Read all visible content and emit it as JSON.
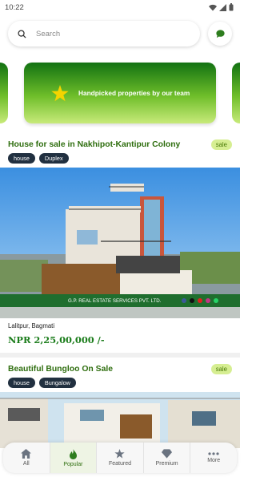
{
  "status": {
    "time": "10:22"
  },
  "search": {
    "placeholder": "Search"
  },
  "banner": {
    "text": "Handpicked properties by our team"
  },
  "listings": [
    {
      "title": "House for sale in Nakhipot-Kantipur Colony",
      "badge": "sale",
      "tags": [
        "house",
        "Duplex"
      ],
      "photo_watermark": "G.P. REAL ESTATE SERVICES PVT. LTD.",
      "location": "Lalitpur, Bagmati",
      "price": "NPR 2,25,00,000 /-"
    },
    {
      "title": "Beautiful Bungloo On Sale",
      "badge": "sale",
      "tags": [
        "house",
        "Bungalow"
      ]
    }
  ],
  "nav": {
    "items": [
      {
        "label": "All",
        "icon": "home-icon"
      },
      {
        "label": "Popular",
        "icon": "fire-icon"
      },
      {
        "label": "Featured",
        "icon": "star-icon"
      },
      {
        "label": "Premium",
        "icon": "diamond-icon"
      },
      {
        "label": "More",
        "icon": "more-dots-icon"
      }
    ],
    "active": "Popular"
  },
  "colors": {
    "accent": "#2f6e0f",
    "banner_green": "#6fbe2a",
    "tag_bg": "#213040",
    "price": "#1c7d1c"
  }
}
